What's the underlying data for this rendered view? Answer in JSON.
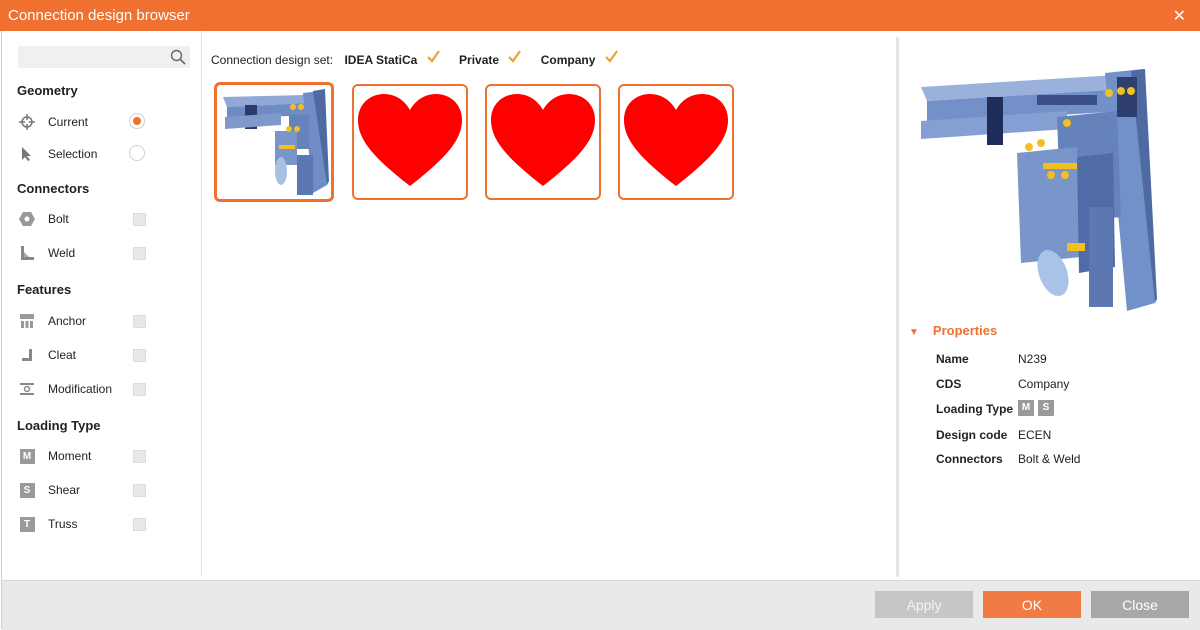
{
  "window": {
    "title": "Connection design browser"
  },
  "search": {
    "placeholder": ""
  },
  "filters": {
    "geometry": {
      "title": "Geometry",
      "items": [
        {
          "label": "Current",
          "selected": true
        },
        {
          "label": "Selection",
          "selected": false
        }
      ]
    },
    "connectors": {
      "title": "Connectors",
      "items": [
        {
          "label": "Bolt"
        },
        {
          "label": "Weld"
        }
      ]
    },
    "features": {
      "title": "Features",
      "items": [
        {
          "label": "Anchor"
        },
        {
          "label": "Cleat"
        },
        {
          "label": "Modification"
        }
      ]
    },
    "loading": {
      "title": "Loading Type",
      "items": [
        {
          "label": "Moment",
          "letter": "M"
        },
        {
          "label": "Shear",
          "letter": "S"
        },
        {
          "label": "Truss",
          "letter": "T"
        }
      ]
    }
  },
  "design_set": {
    "label": "Connection design set:",
    "options": [
      {
        "label": "IDEA StatiCa",
        "checked": true
      },
      {
        "label": "Private",
        "checked": true
      },
      {
        "label": "Company",
        "checked": true
      }
    ]
  },
  "tiles": [
    {
      "kind": "connection-model",
      "selected": true
    },
    {
      "kind": "heart"
    },
    {
      "kind": "heart"
    },
    {
      "kind": "heart"
    }
  ],
  "properties": {
    "title": "Properties",
    "rows": [
      {
        "key": "Name",
        "value": "N239"
      },
      {
        "key": "CDS",
        "value": "Company"
      },
      {
        "key": "Loading Type",
        "tags": [
          "M",
          "S"
        ]
      },
      {
        "key": "Design code",
        "value": "ECEN"
      },
      {
        "key": "Connectors",
        "value": "Bolt & Weld"
      }
    ]
  },
  "buttons": {
    "apply": "Apply",
    "ok": "OK",
    "close": "Close"
  },
  "colors": {
    "accent": "#f07030",
    "heart": "#ff0000",
    "steel": "#7a9ad0",
    "bolt": "#f0c020"
  }
}
